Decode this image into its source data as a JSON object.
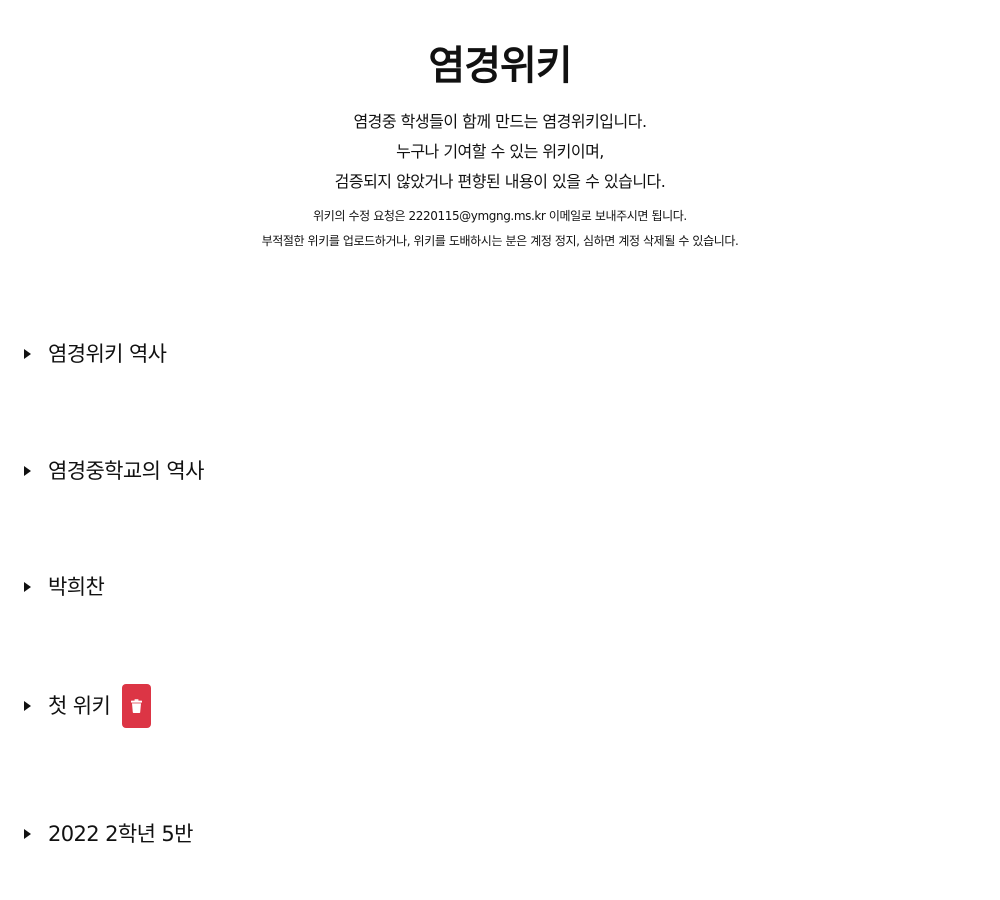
{
  "header": {
    "title": "염경위키",
    "intro": [
      "염경중 학생들이 함께 만드는 염경위키입니다.",
      "누구나 기여할 수 있는 위키이며,",
      "검증되지 않았거나 편향된 내용이 있을 수 있습니다."
    ],
    "notice": [
      "위키의 수정 요청은 2220115@ymgng.ms.kr 이메일로 보내주시면 됩니다.",
      "부적절한 위키를 업로드하거나, 위키를 도배하시는 분은 계정 정지, 심하면 계정 삭제될 수 있습니다."
    ]
  },
  "wiki_items": [
    {
      "label": "염경위키 역사"
    },
    {
      "label": "염경중학교의 역사"
    },
    {
      "label": "박희찬"
    },
    {
      "label": "첫 위키",
      "has_delete": true
    },
    {
      "label": "2022 2학년 5반"
    }
  ],
  "icons": {
    "expand": "caret-right-icon",
    "delete": "trash-icon"
  },
  "colors": {
    "delete_button": "#dc3545",
    "text": "#111111",
    "background": "#ffffff"
  }
}
